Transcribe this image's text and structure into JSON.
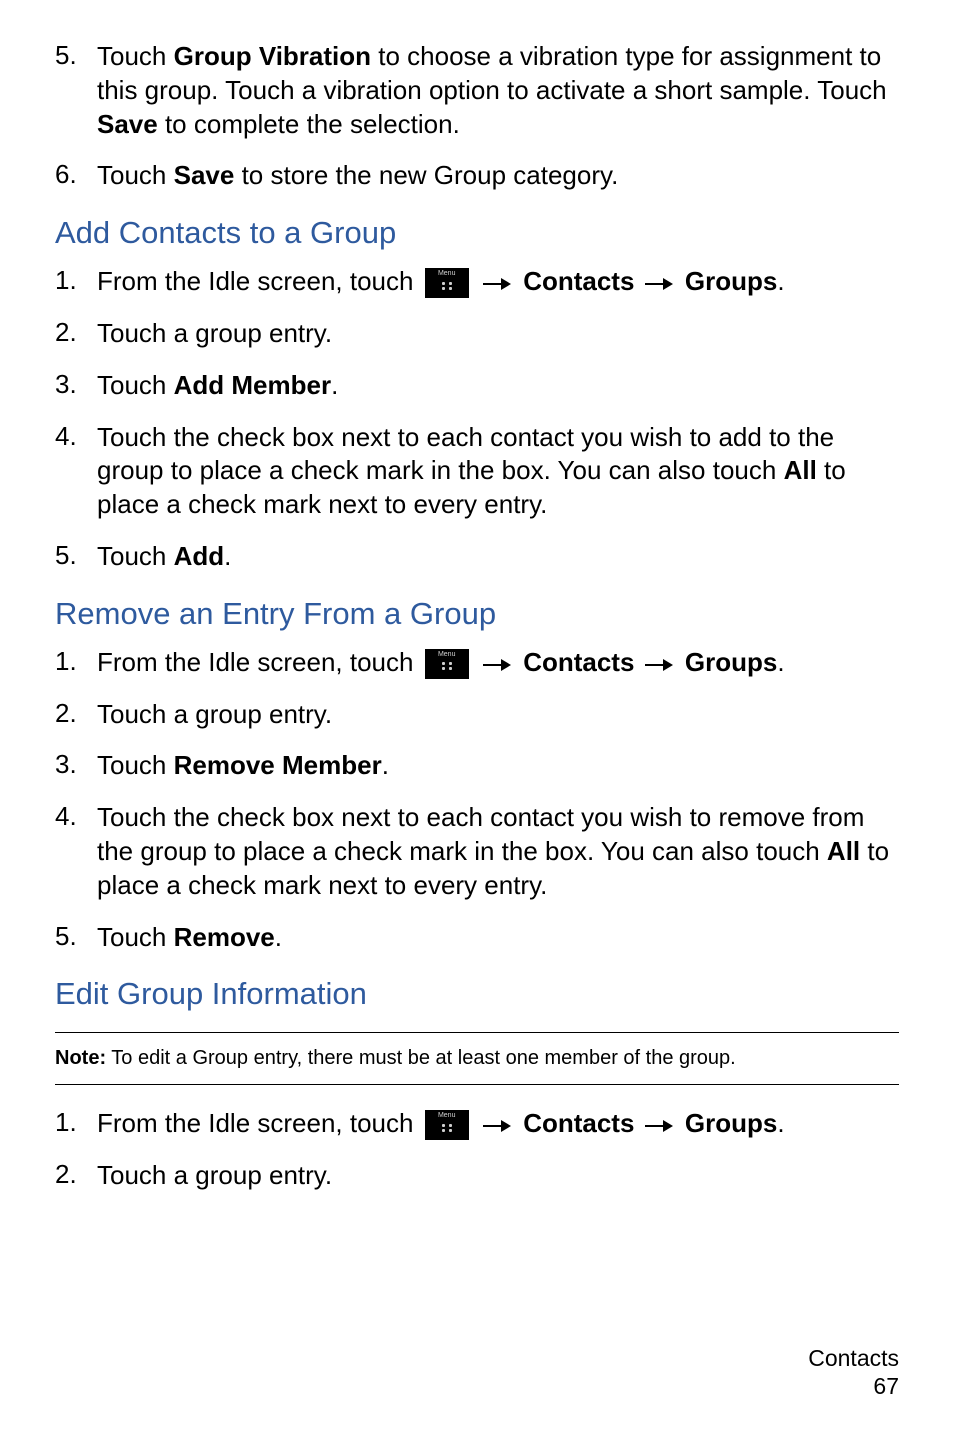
{
  "lists": {
    "intro": [
      {
        "num": "5.",
        "parts": [
          {
            "t": "Touch "
          },
          {
            "t": "Group Vibration",
            "b": true
          },
          {
            "t": " to choose a vibration type for assignment to this group. Touch a vibration option to activate a short sample. Touch "
          },
          {
            "t": "Save",
            "b": true
          },
          {
            "t": " to complete the selection."
          }
        ]
      },
      {
        "num": "6.",
        "parts": [
          {
            "t": "Touch "
          },
          {
            "t": "Save",
            "b": true
          },
          {
            "t": " to store the new Group category."
          }
        ]
      }
    ],
    "add": [
      {
        "num": "1.",
        "parts": [
          {
            "t": "From the Idle screen, touch  "
          },
          {
            "icon": true
          },
          {
            "t": "  "
          },
          {
            "arrow": true
          },
          {
            "t": " "
          },
          {
            "t": "Contacts",
            "b": true
          },
          {
            "t": " "
          },
          {
            "arrow": true
          },
          {
            "t": " "
          },
          {
            "t": "Groups",
            "b": true
          },
          {
            "t": "."
          }
        ]
      },
      {
        "num": "2.",
        "parts": [
          {
            "t": "Touch a group entry."
          }
        ]
      },
      {
        "num": "3.",
        "parts": [
          {
            "t": "Touch "
          },
          {
            "t": "Add Member",
            "b": true
          },
          {
            "t": "."
          }
        ]
      },
      {
        "num": "4.",
        "parts": [
          {
            "t": " Touch the check box next to each contact you wish to add to the group to place a check mark in the box. You can also touch "
          },
          {
            "t": "All",
            "b": true
          },
          {
            "t": " to place a check mark next to every entry."
          }
        ]
      },
      {
        "num": "5.",
        "parts": [
          {
            "t": "Touch "
          },
          {
            "t": "Add",
            "b": true
          },
          {
            "t": "."
          }
        ]
      }
    ],
    "remove": [
      {
        "num": "1.",
        "parts": [
          {
            "t": "From the Idle screen, touch  "
          },
          {
            "icon": true
          },
          {
            "t": "  "
          },
          {
            "arrow": true
          },
          {
            "t": " "
          },
          {
            "t": "Contacts",
            "b": true
          },
          {
            "t": " "
          },
          {
            "arrow": true
          },
          {
            "t": " "
          },
          {
            "t": "Groups",
            "b": true
          },
          {
            "t": "."
          }
        ]
      },
      {
        "num": "2.",
        "parts": [
          {
            "t": "Touch a group entry."
          }
        ]
      },
      {
        "num": "3.",
        "parts": [
          {
            "t": "Touch "
          },
          {
            "t": "Remove Member",
            "b": true
          },
          {
            "t": "."
          }
        ]
      },
      {
        "num": "4.",
        "parts": [
          {
            "t": " Touch the check box next to each contact you wish to remove from the group to place a check mark in the box. You can also touch "
          },
          {
            "t": "All",
            "b": true
          },
          {
            "t": " to place a check mark next to every entry."
          }
        ]
      },
      {
        "num": "5.",
        "parts": [
          {
            "t": "Touch "
          },
          {
            "t": "Remove",
            "b": true
          },
          {
            "t": "."
          }
        ]
      }
    ],
    "edit": [
      {
        "num": "1.",
        "parts": [
          {
            "t": "From the Idle screen, touch  "
          },
          {
            "icon": true
          },
          {
            "t": "  "
          },
          {
            "arrow": true
          },
          {
            "t": " "
          },
          {
            "t": "Contacts",
            "b": true
          },
          {
            "t": " "
          },
          {
            "arrow": true
          },
          {
            "t": " "
          },
          {
            "t": "Groups",
            "b": true
          },
          {
            "t": "."
          }
        ]
      },
      {
        "num": "2.",
        "parts": [
          {
            "t": "Touch a group entry."
          }
        ]
      }
    ]
  },
  "headings": {
    "add": "Add Contacts to a Group",
    "remove": "Remove an Entry From a Group",
    "edit": "Edit Group Information"
  },
  "note": {
    "label": "Note:",
    "text": " To edit a Group entry, there must be at least one member of the group."
  },
  "footer": {
    "section": "Contacts",
    "page": "67"
  }
}
